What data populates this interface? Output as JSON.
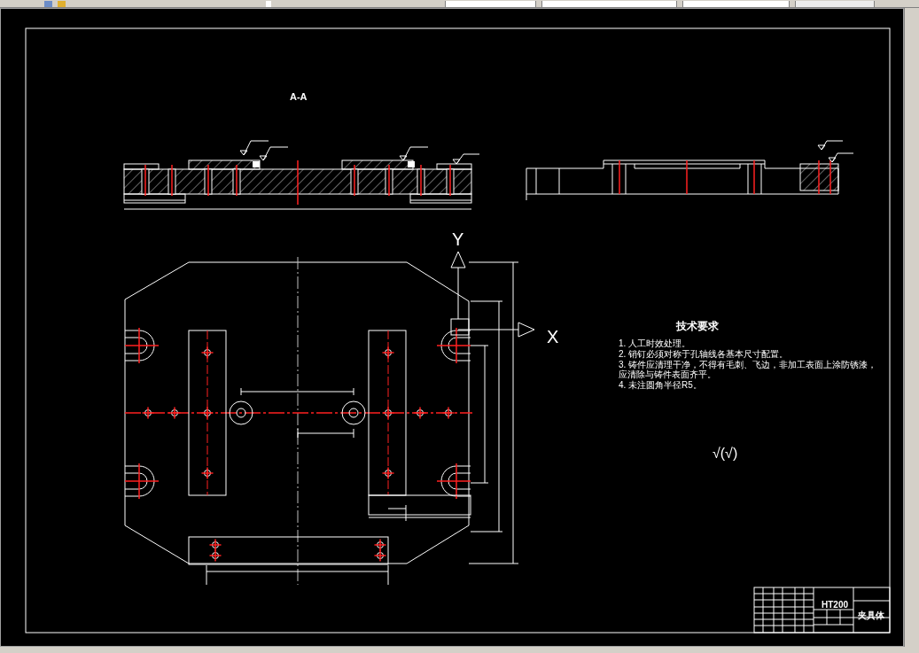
{
  "drawing": {
    "section_label": "A-A",
    "y_axis_label": "Y",
    "x_axis_label": "X",
    "technical_requirements": {
      "title": "技术要求",
      "items": [
        "1. 人工时效处理。",
        "2. 销钉必须对称于孔轴线各基本尺寸配置。",
        "3. 铸件应清理干净，不得有毛刺、飞边，非加工表面上涂防锈漆，应清除与铸件表面齐平。",
        "4. 未注圆角半径R5。"
      ]
    },
    "surface_finish_note": "√(√)",
    "title_block": {
      "material": "HT200",
      "part_name": "夹具体"
    }
  }
}
